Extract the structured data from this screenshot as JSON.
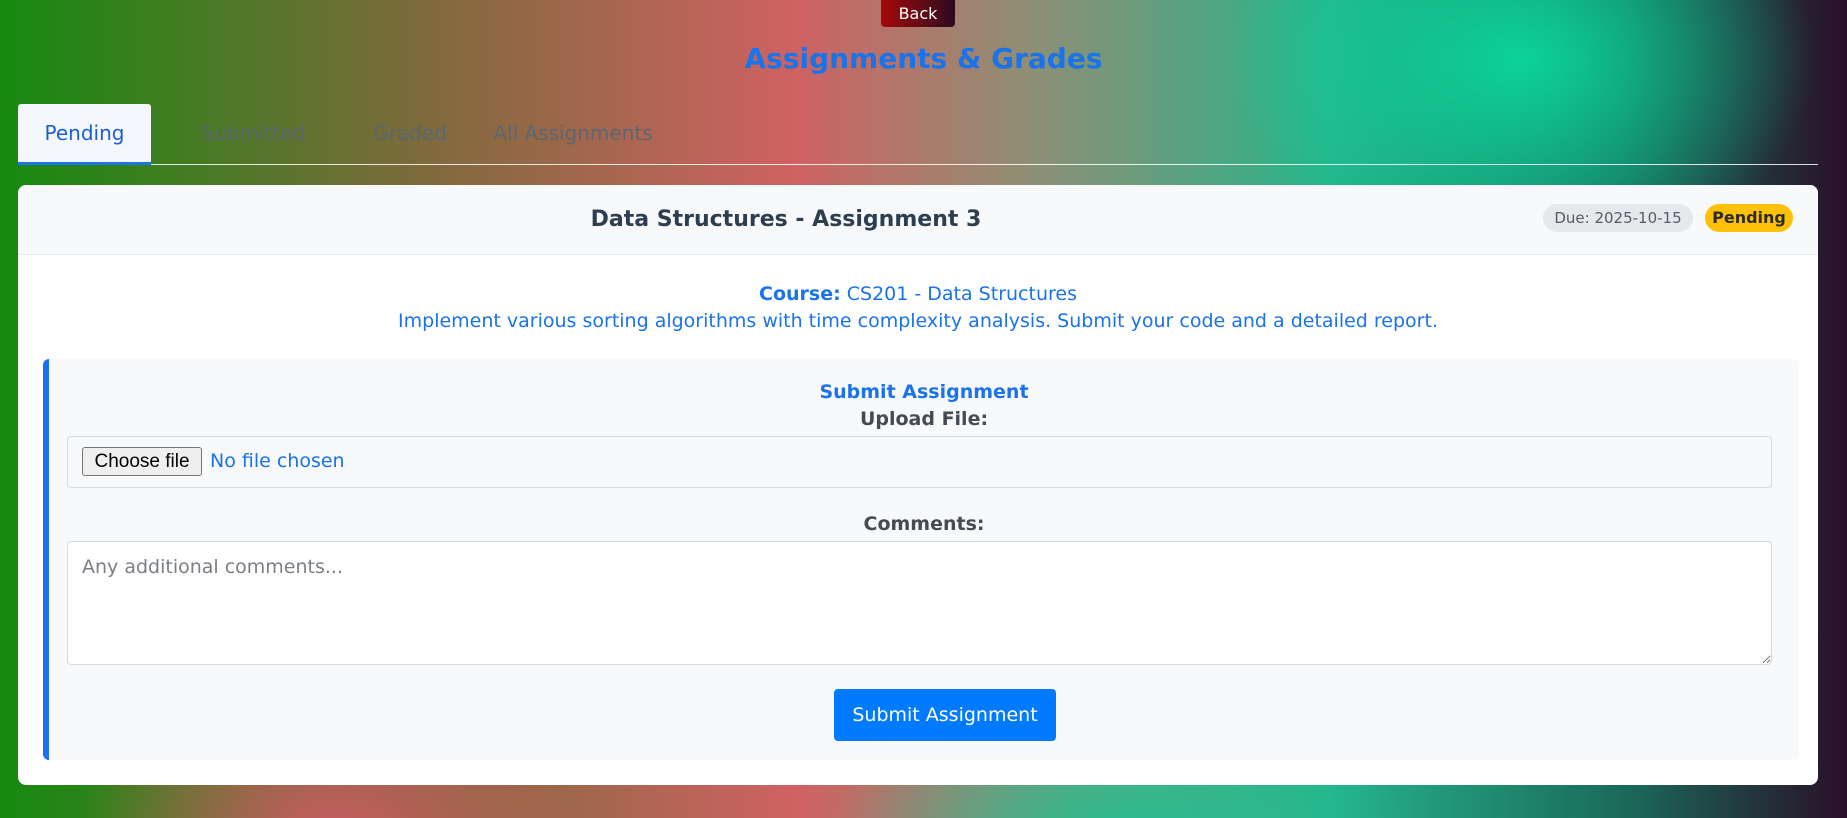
{
  "header": {
    "back_label": "Back",
    "title": "Assignments & Grades"
  },
  "tabs": [
    {
      "label": "Pending",
      "active": true
    },
    {
      "label": "Submitted",
      "active": false
    },
    {
      "label": "Graded",
      "active": false
    },
    {
      "label": "All Assignments",
      "active": false
    }
  ],
  "assignment": {
    "title": "Data Structures - Assignment 3",
    "due": "Due: 2025-10-15",
    "status": "Pending",
    "course_label": "Course:",
    "course_value": "CS201 - Data Structures",
    "description": "Implement various sorting algorithms with time complexity analysis. Submit your code and a detailed report."
  },
  "submission": {
    "panel_title": "Submit Assignment",
    "upload_label": "Upload File:",
    "choose_file_label": "Choose file",
    "file_status": "No file chosen",
    "comments_label": "Comments:",
    "comments_placeholder": "Any additional comments...",
    "comments_value": "",
    "submit_label": "Submit Assignment"
  },
  "colors": {
    "accent": "#1a73e8",
    "primary_button": "#007bff",
    "status_pending": "#ffc107",
    "back_button": "#a40a0a"
  }
}
